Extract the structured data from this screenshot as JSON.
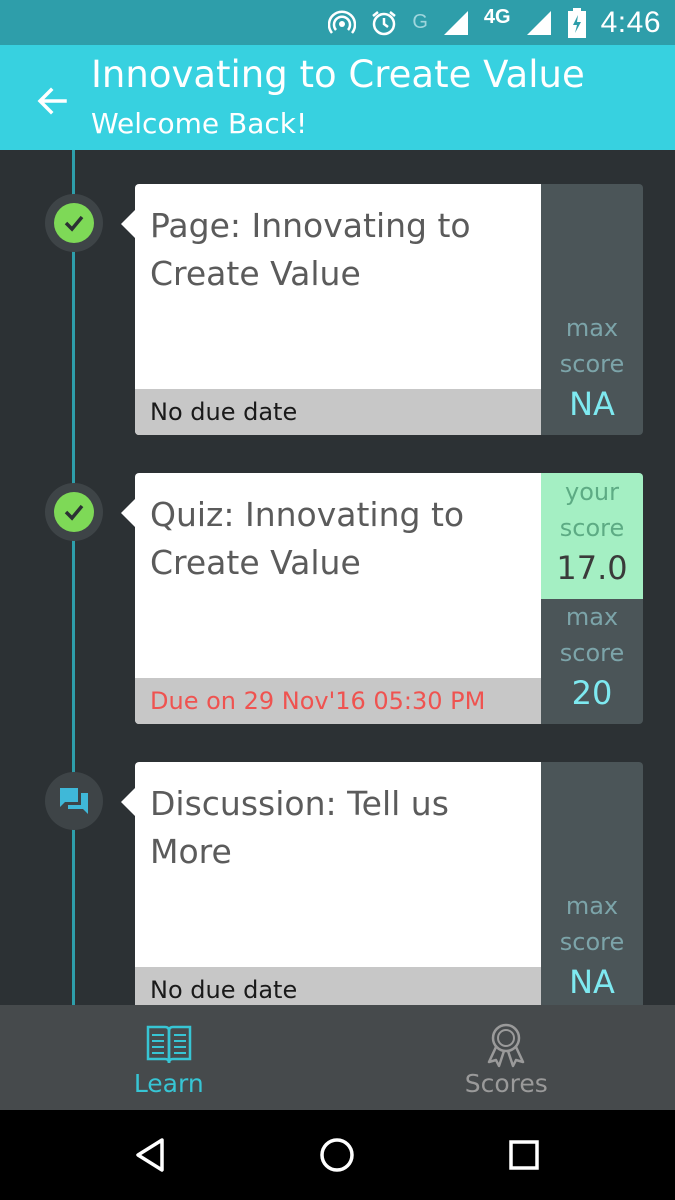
{
  "status_bar": {
    "time": "4:46",
    "network_label": "4G",
    "g_label": "G",
    "icons": [
      "hotspot-icon",
      "alarm-icon",
      "signal-icon",
      "battery-icon"
    ]
  },
  "app_bar": {
    "title": "Innovating to Create Value",
    "subtitle": "Welcome Back!",
    "back_icon": "arrow-left-icon"
  },
  "colors": {
    "app_bar": "#37d1e0",
    "status_bar": "#2e9eaa",
    "background": "#2c3134",
    "accent": "#37c5d4",
    "completed": "#7ed957",
    "overdue": "#ef5350",
    "your_score_bg": "#a4efc3"
  },
  "items": [
    {
      "title": "Page: Innovating to Create Value",
      "due": "No due date",
      "status_icon": "check-circle-icon",
      "max_score_label": "max score",
      "max_score": "NA"
    },
    {
      "title": "Quiz: Innovating to Create Value",
      "due": "Due on 29 Nov'16 05:30 PM",
      "status_icon": "check-circle-icon",
      "your_score_label": "your score",
      "your_score": "17.0",
      "max_score_label": "max score",
      "max_score": "20"
    },
    {
      "title": "Discussion: Tell us More",
      "due": "No due date",
      "status_icon": "discussion-icon",
      "max_score_label": "max score",
      "max_score": "NA"
    }
  ],
  "bottom_nav": {
    "tabs": [
      {
        "label": "Learn",
        "icon": "book-icon",
        "active": true
      },
      {
        "label": "Scores",
        "icon": "award-ribbon-icon",
        "active": false
      }
    ]
  },
  "system_nav": [
    "back-triangle-icon",
    "home-circle-icon",
    "recents-square-icon"
  ]
}
